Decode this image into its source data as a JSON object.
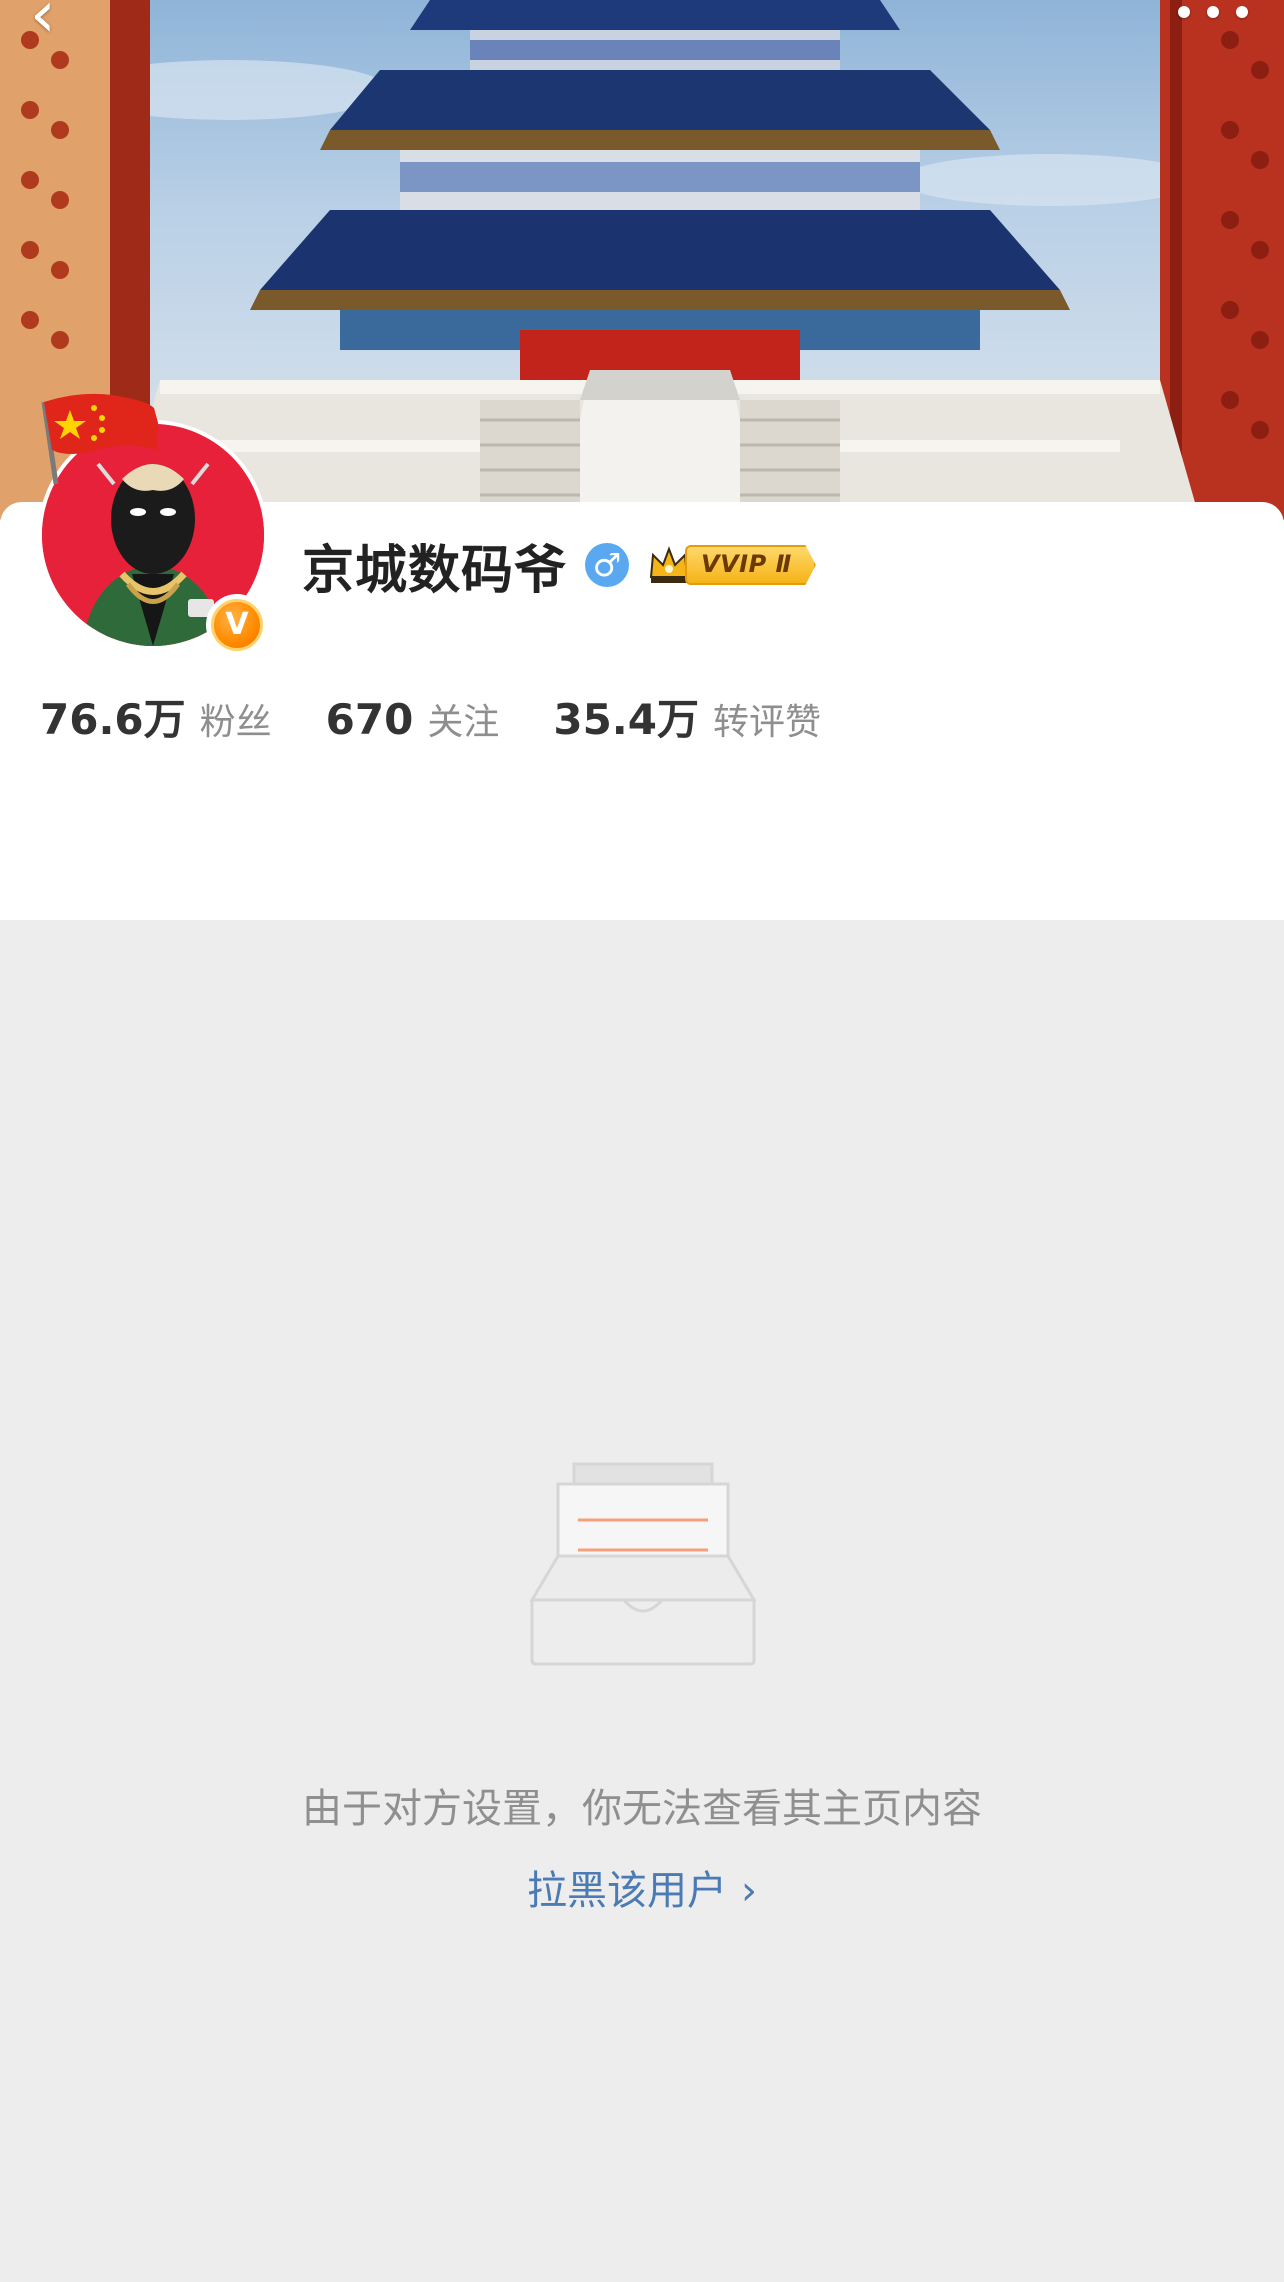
{
  "nav": {
    "back_icon": "chevron-left-icon",
    "more_icon": "more-dots-icon"
  },
  "profile": {
    "username": "京城数码爷",
    "gender_symbol": "♂",
    "vip_label": "VVIP Ⅱ",
    "verified_mark": "V",
    "stats": [
      {
        "value": "76.6万",
        "label": "粉丝"
      },
      {
        "value": "670",
        "label": "关注"
      },
      {
        "value": "35.4万",
        "label": "转评赞"
      }
    ]
  },
  "empty_state": {
    "message": "由于对方设置，你无法查看其主页内容",
    "block_link": "拉黑该用户",
    "block_chevron": "›"
  },
  "colors": {
    "page_bg": "#ededed",
    "card_bg": "#ffffff",
    "link": "#4a7bb5",
    "muted_text": "#8f8f8f",
    "vip_gold": "#f5b418",
    "verified_orange": "#ff8a00",
    "gender_blue": "#5aa9f0"
  }
}
